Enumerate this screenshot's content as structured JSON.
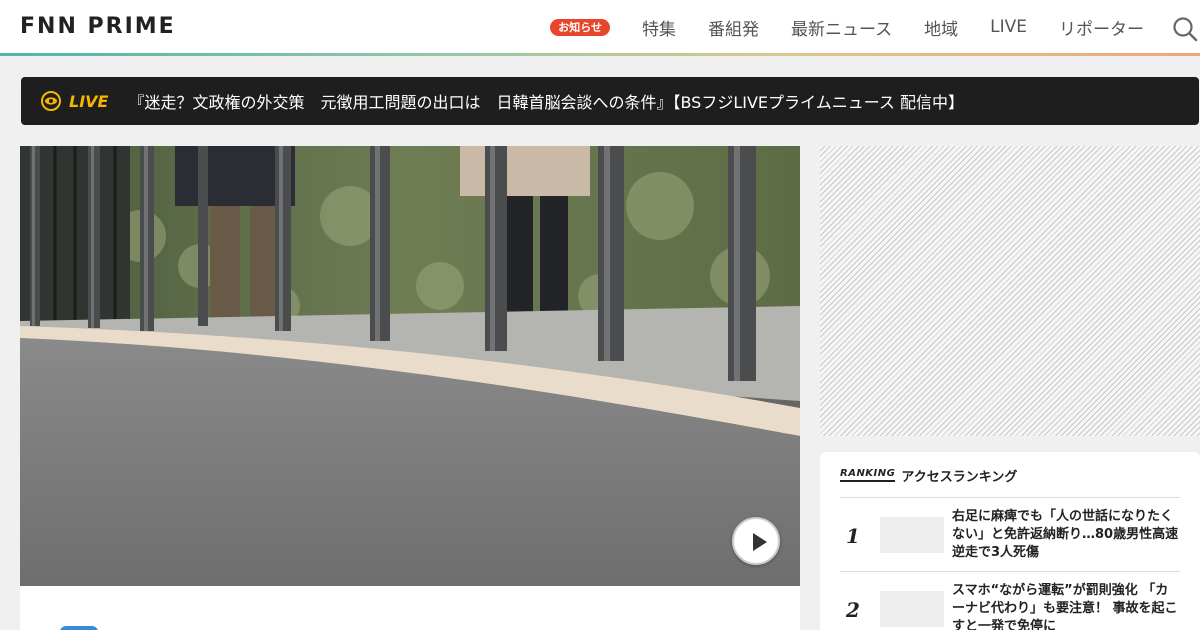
{
  "header": {
    "logo": "FNN PRIME",
    "badge": "お知らせ",
    "nav": [
      "特集",
      "番組発",
      "最新ニュース",
      "地域",
      "LIVE",
      "リポーター"
    ]
  },
  "live": {
    "label": "LIVE",
    "title": "『迷走？文政権の外交策　元徴用工問題の出口は　日韓首脳会談への条件』【BSフジLIVEプライムニュース 配信中】"
  },
  "ranking": {
    "label_en": "RANKING",
    "label_ja": "アクセスランキング",
    "items": [
      {
        "rank": "1",
        "title": "右足に麻痺でも「人の世話になりたくない」と免許返納断り…80歳男性高速逆走で3人死傷"
      },
      {
        "rank": "2",
        "title": "スマホ“ながら運転”が罰則強化 「カーナビ代わり」も要注意！ 事故を起こすと一発で免停に"
      }
    ]
  },
  "colors": {
    "accent": "#e8462b",
    "live": "#f5b500",
    "brand": "#2a9d8f"
  }
}
